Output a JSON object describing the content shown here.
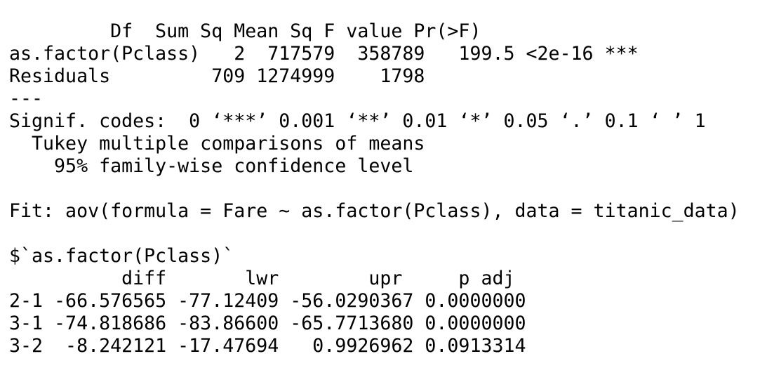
{
  "console": {
    "lines": [
      "         Df  Sum Sq Mean Sq F value Pr(>F)    ",
      "as.factor(Pclass)   2  717579  358789   199.5 <2e-16 ***",
      "Residuals         709 1274999    1798                   ",
      "---",
      "Signif. codes:  0 ‘***’ 0.001 ‘**’ 0.01 ‘*’ 0.05 ‘.’ 0.1 ‘ ’ 1",
      "  Tukey multiple comparisons of means",
      "    95% family-wise confidence level",
      "",
      "Fit: aov(formula = Fare ~ as.factor(Pclass), data = titanic_data)",
      "",
      "$`as.factor(Pclass)`",
      "          diff       lwr        upr     p adj",
      "2-1 -66.576565 -77.12409 -56.0290367 0.0000000",
      "3-1 -74.818686 -83.86600 -65.7713680 0.0000000",
      "3-2  -8.242121 -17.47694   0.9926962 0.0913314"
    ]
  }
}
